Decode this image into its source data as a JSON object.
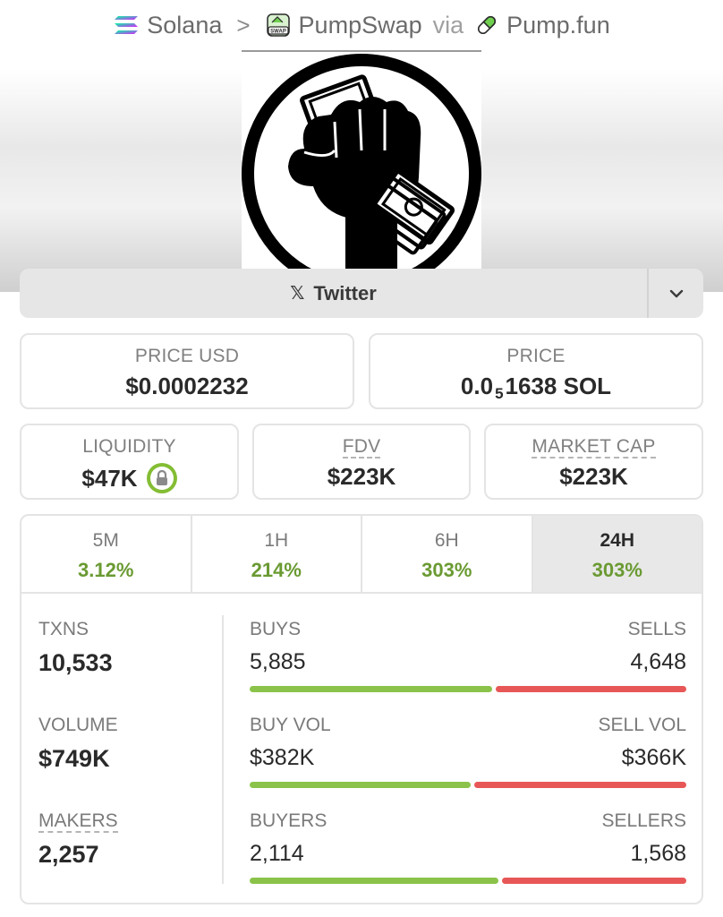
{
  "breadcrumb": {
    "chain": "Solana",
    "separator": ">",
    "dex": "PumpSwap",
    "swap_badge": "SWAP",
    "via": "via",
    "launchpad": "Pump.fun"
  },
  "links": {
    "twitter_label": "Twitter",
    "x_icon": "𝕏"
  },
  "prices": {
    "price_usd_label": "PRICE USD",
    "price_usd_value": "$0.0002232",
    "price_label": "PRICE",
    "price_prefix": "0.0",
    "price_subscript": "5",
    "price_suffix": "1638 SOL"
  },
  "metrics_top": {
    "liquidity_label": "LIQUIDITY",
    "liquidity_value": "$47K",
    "fdv_label": "FDV",
    "fdv_value": "$223K",
    "mcap_label": "MARKET CAP",
    "mcap_value": "$223K"
  },
  "timeframes": [
    {
      "label": "5M",
      "value": "3.12%"
    },
    {
      "label": "1H",
      "value": "214%"
    },
    {
      "label": "6H",
      "value": "303%"
    },
    {
      "label": "24H",
      "value": "303%"
    }
  ],
  "active_timeframe": "24H",
  "rows": {
    "txns": {
      "label": "TXNS",
      "value": "10,533",
      "buy_label": "BUYS",
      "buy_value": "5,885",
      "sell_label": "SELLS",
      "sell_value": "4,648",
      "buy_fraction": 0.559
    },
    "volume": {
      "label": "VOLUME",
      "value": "$749K",
      "buy_label": "BUY VOL",
      "buy_value": "$382K",
      "sell_label": "SELL VOL",
      "sell_value": "$366K",
      "buy_fraction": 0.51
    },
    "makers": {
      "label": "MAKERS",
      "value": "2,257",
      "buy_label": "BUYERS",
      "buy_value": "2,114",
      "sell_label": "SELLERS",
      "sell_value": "1,568",
      "buy_fraction": 0.574
    }
  },
  "colors": {
    "positive": "#6a9a32",
    "buy_bar": "#8bc34a",
    "sell_bar": "#e85757",
    "lock": "#84bd34"
  }
}
